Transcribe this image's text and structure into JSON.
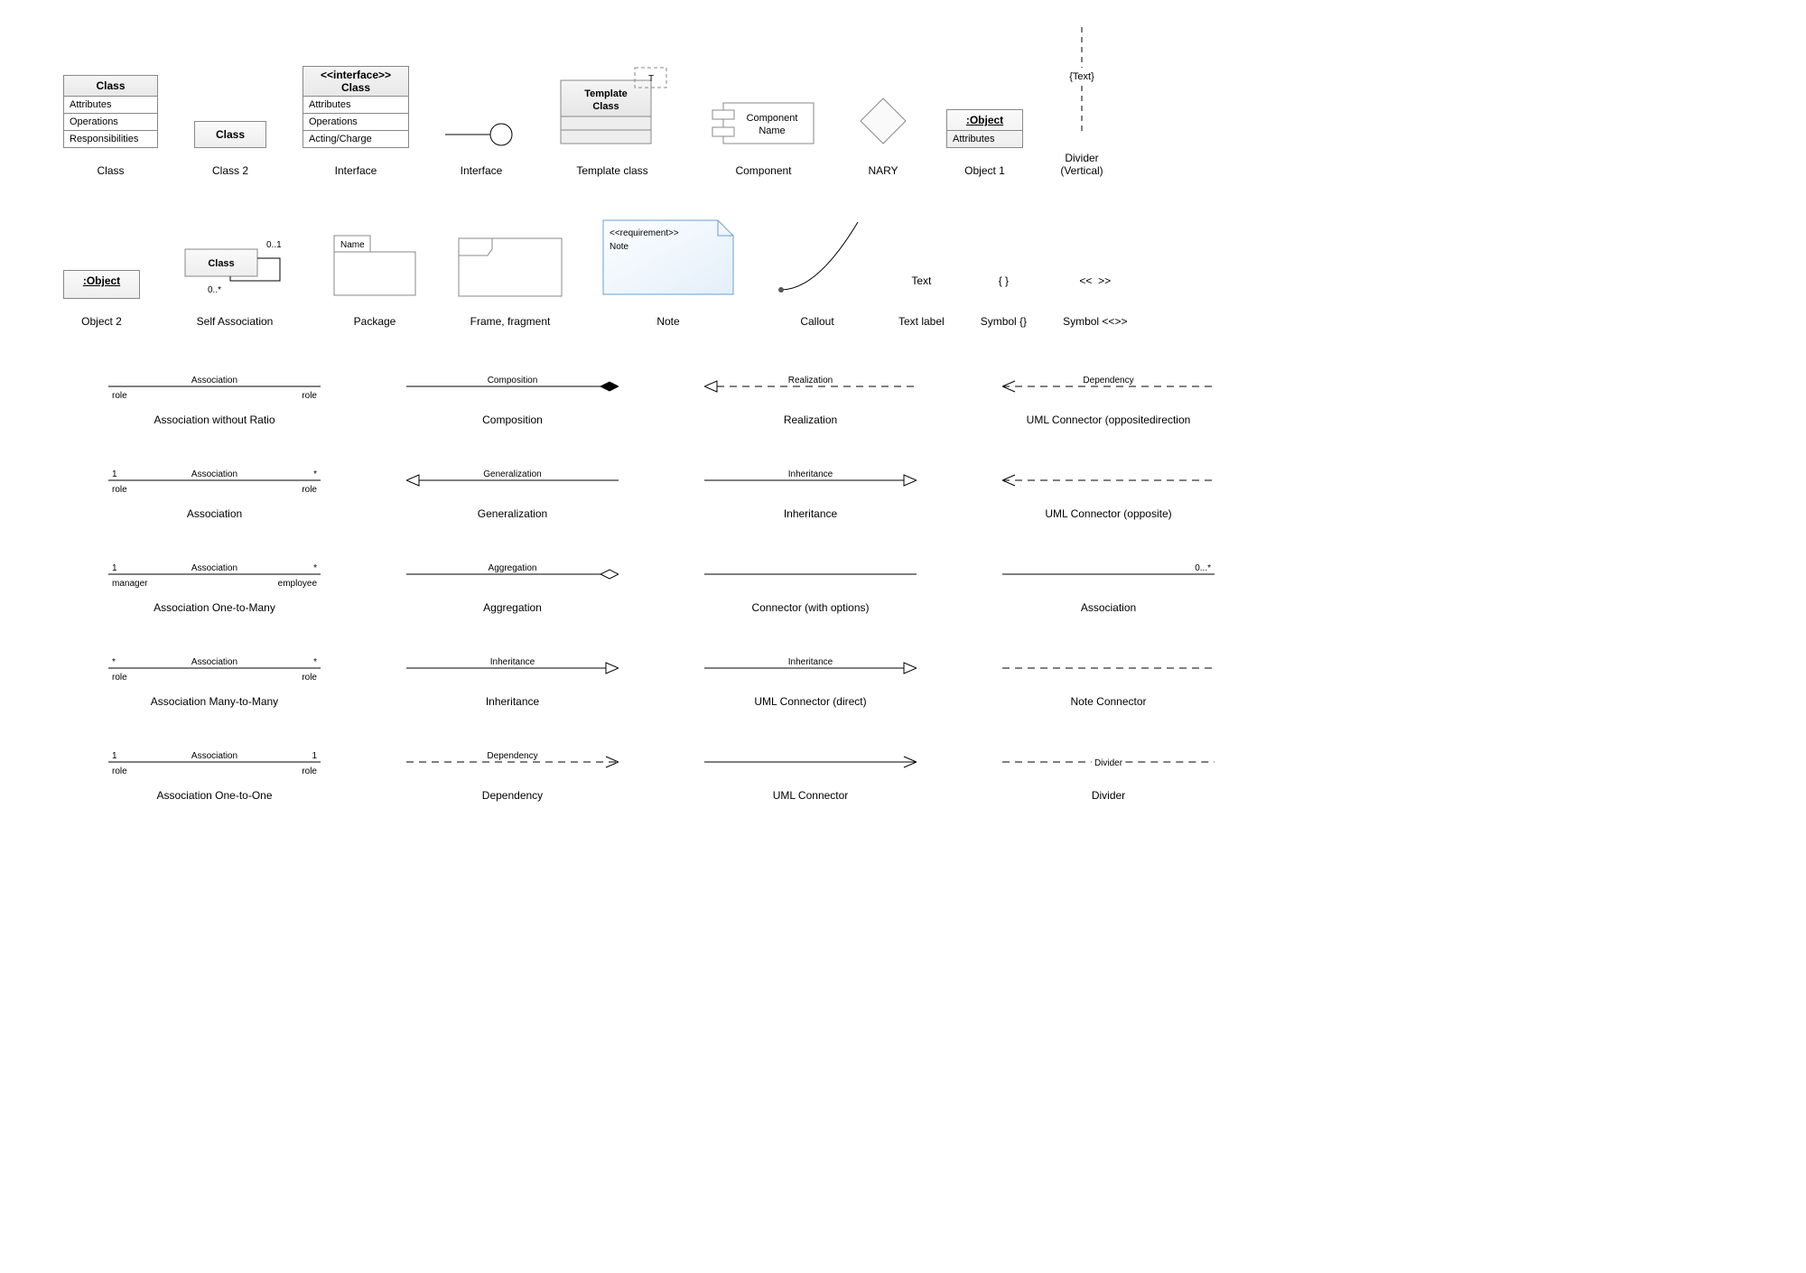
{
  "row1": {
    "class": {
      "title": "Class",
      "attr": "Attributes",
      "op": "Operations",
      "resp": "Responsibilities",
      "cap": "Class"
    },
    "class2": {
      "title": "Class",
      "cap": "Class 2"
    },
    "interface": {
      "stereo": "<<interface>>",
      "title": "Class",
      "attr": "Attributes",
      "op": "Operations",
      "act": "Acting/Charge",
      "cap": "Interface"
    },
    "lollipop": {
      "cap": "Interface"
    },
    "template": {
      "param": "T",
      "title": "Template\nClass",
      "cap": "Template class"
    },
    "component": {
      "label": "Component\nName",
      "cap": "Component"
    },
    "nary": {
      "cap": "NARY"
    },
    "object1": {
      "title": ":Object",
      "attr": "Attributes",
      "cap": "Object 1"
    },
    "divider": {
      "label": "{Text}",
      "cap": "Divider\n(Vertical)"
    }
  },
  "row2": {
    "object2": {
      "title": ":Object",
      "cap": "Object 2"
    },
    "selfassoc": {
      "title": "Class",
      "mult1": "0..1",
      "mult2": "0..*",
      "cap": "Self Association"
    },
    "package": {
      "tab": "Name",
      "cap": "Package"
    },
    "frame": {
      "cap": "Frame, fragment"
    },
    "note": {
      "stereo": "<<requirement>>",
      "text": "Note",
      "cap": "Note"
    },
    "callout": {
      "cap": "Callout"
    },
    "textlabel": {
      "sample": "Text",
      "cap": "Text label"
    },
    "symbolbrace": {
      "sample": "{ }",
      "cap": "Symbol {}"
    },
    "symbolangle": {
      "sample": "<<  >>",
      "cap": "Symbol <<>>"
    }
  },
  "connectors": [
    [
      {
        "name": "assoc-no-ratio",
        "label": "Association",
        "left": "role",
        "right": "role",
        "cap": "Association without Ratio",
        "kind": "plain",
        "roles": true
      },
      {
        "name": "composition",
        "label": "Composition",
        "cap": "Composition",
        "kind": "diamond_filled"
      },
      {
        "name": "realization",
        "label": "Realization",
        "cap": "Realization",
        "kind": "dash_tri_left"
      },
      {
        "name": "uml-opp-dep",
        "label": "Dependency",
        "cap": "UML Connector (oppositedirection",
        "kind": "dash_open_left"
      }
    ],
    [
      {
        "name": "association",
        "label": "Association",
        "left": "role",
        "right": "role",
        "lmult": "1",
        "rmult": "*",
        "cap": "Association",
        "kind": "plain",
        "roles": true
      },
      {
        "name": "generalization",
        "label": "Generalization",
        "cap": "Generalization",
        "kind": "tri_left"
      },
      {
        "name": "inheritance",
        "label": "Inheritance",
        "cap": "Inheritance",
        "kind": "tri_right"
      },
      {
        "name": "uml-opposite",
        "label": "",
        "cap": "UML Connector (opposite)",
        "kind": "dash_open_left"
      }
    ],
    [
      {
        "name": "assoc-1-many",
        "label": "Association",
        "left": "manager",
        "right": "employee",
        "lmult": "1",
        "rmult": "*",
        "cap": "Association One-to-Many",
        "kind": "plain",
        "roles": true
      },
      {
        "name": "aggregation",
        "label": "Aggregation",
        "cap": "Aggregation",
        "kind": "diamond_open"
      },
      {
        "name": "conn-options",
        "label": "",
        "cap": "Connector (with options)",
        "kind": "plain"
      },
      {
        "name": "association2",
        "label": "",
        "rmult": "0...*",
        "cap": "Association",
        "kind": "plain",
        "rmultOnly": true
      }
    ],
    [
      {
        "name": "assoc-many-many",
        "label": "Association",
        "left": "role",
        "right": "role",
        "lmult": "*",
        "rmult": "*",
        "cap": "Association Many-to-Many",
        "kind": "plain",
        "roles": true
      },
      {
        "name": "inheritance2",
        "label": "Inheritance",
        "cap": "Inheritance",
        "kind": "tri_right"
      },
      {
        "name": "uml-direct",
        "label": "Inheritance",
        "cap": "UML Connector (direct)",
        "kind": "tri_right"
      },
      {
        "name": "note-conn",
        "label": "",
        "cap": "Note Connector",
        "kind": "dash_plain"
      }
    ],
    [
      {
        "name": "assoc-1-1",
        "label": "Association",
        "left": "role",
        "right": "role",
        "lmult": "1",
        "rmult": "1",
        "cap": "Association One-to-One",
        "kind": "plain",
        "roles": true
      },
      {
        "name": "dependency",
        "label": "Dependency",
        "cap": "Dependency",
        "kind": "dash_open_right"
      },
      {
        "name": "uml-conn",
        "label": "",
        "cap": "UML Connector",
        "kind": "open_right"
      },
      {
        "name": "divider-h",
        "label": "Divider",
        "cap": "Divider",
        "kind": "dash_label"
      }
    ]
  ]
}
